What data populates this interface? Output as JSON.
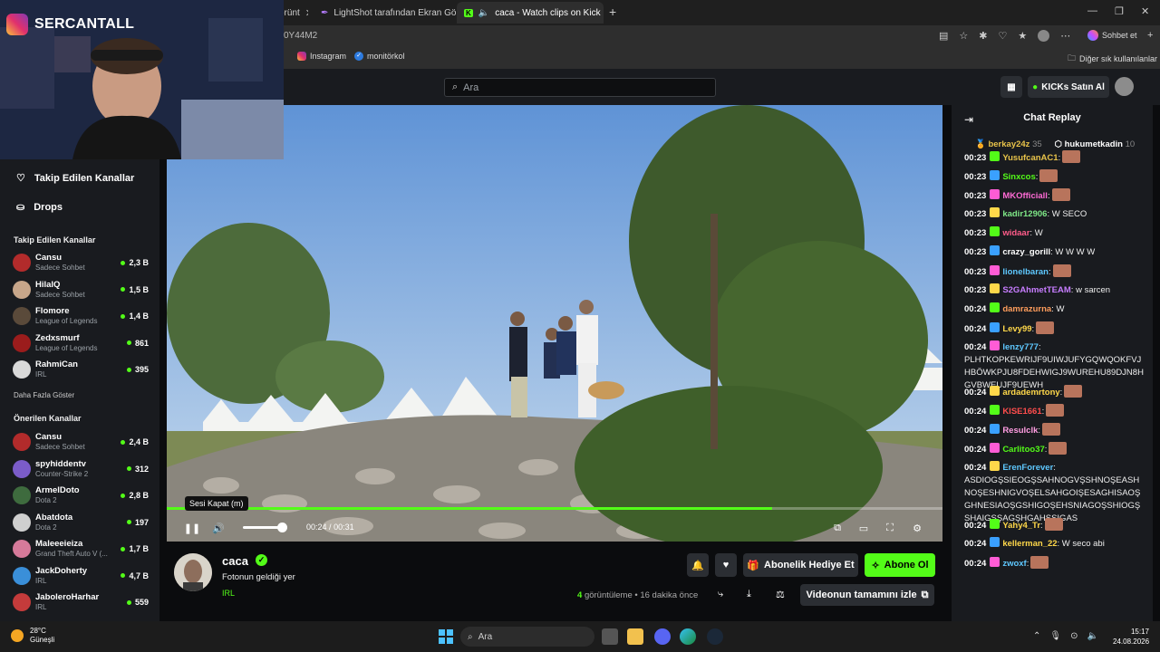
{
  "browser": {
    "tabs": [
      {
        "title": "örünt"
      },
      {
        "title": "LightShot tarafından Ekran Görünt"
      },
      {
        "title": "caca - Watch clips on Kick",
        "active": true
      }
    ],
    "address_fragment": "0Y44M2",
    "chat_button": "Sohbet et",
    "bookmarks": [
      "Instagram",
      "monitörkol"
    ],
    "other_bookmarks": "Diğer sık kullanılanlar"
  },
  "webcam": {
    "instagram_handle": "SERCANTALL"
  },
  "kick": {
    "search_placeholder": "Ara",
    "buy_kicks": "KICKs Satın Al",
    "sidebar": {
      "nav": [
        "Takip Edilen Kanallar",
        "Drops"
      ],
      "followed_heading": "Takip Edilen Kanallar",
      "followed": [
        {
          "name": "Cansu",
          "game": "Sadece Sohbet",
          "viewers": "2,3 B",
          "color": "#b22b2b"
        },
        {
          "name": "HilalQ",
          "game": "Sadece Sohbet",
          "viewers": "1,5 B",
          "color": "#c7a68a"
        },
        {
          "name": "Flomore",
          "game": "League of Legends",
          "viewers": "1,4 B",
          "color": "#5a4a3a"
        },
        {
          "name": "Zedxsmurf",
          "game": "League of Legends",
          "viewers": "861",
          "color": "#9b1c1c"
        },
        {
          "name": "RahmiCan",
          "game": "IRL",
          "viewers": "395",
          "color": "#d9d9d9"
        }
      ],
      "show_more": "Daha Fazla Göster",
      "recommended_heading": "Önerilen Kanallar",
      "recommended": [
        {
          "name": "Cansu",
          "game": "Sadece Sohbet",
          "viewers": "2,4 B",
          "color": "#b22b2b"
        },
        {
          "name": "spyhiddentv",
          "game": "Counter-Strike 2",
          "viewers": "312",
          "color": "#7b5cc9"
        },
        {
          "name": "ArmelDoto",
          "game": "Dota 2",
          "viewers": "2,8 B",
          "color": "#3e6b3e"
        },
        {
          "name": "Abatdota",
          "game": "Dota 2",
          "viewers": "197",
          "color": "#cfcfcf"
        },
        {
          "name": "Maleeeieiza",
          "game": "Grand Theft Auto V (...",
          "viewers": "1,7 B",
          "color": "#d67a9a"
        },
        {
          "name": "JackDoherty",
          "game": "IRL",
          "viewers": "4,7 B",
          "color": "#3a8fd9"
        },
        {
          "name": "JaboleroHarhar",
          "game": "IRL",
          "viewers": "559",
          "color": "#c43b3b"
        }
      ]
    },
    "player": {
      "tooltip": "Sesi Kapat (m)",
      "time_current": "00:24",
      "time_separator": "/",
      "time_total": "00:31",
      "progress": 0.78,
      "volume": 0.85
    },
    "clip": {
      "channel": "caca",
      "title": "Fotonun geldiği yer",
      "category": "IRL",
      "views_count": "4",
      "views_label": "görüntüleme",
      "age": "• 16 dakika önce",
      "gift_sub": "Abonelik Hediye Et",
      "subscribe": "Abone Ol",
      "watch_full": "Videonun tamamını izle"
    },
    "chat": {
      "title": "Chat Replay",
      "pinned": [
        {
          "user": "berkay24z",
          "count": "35"
        },
        {
          "user": "hukumetkadin",
          "count": "10"
        }
      ],
      "messages": [
        {
          "time": "00:23",
          "user": "YusufcanAC1",
          "color": "#e8c34a",
          "text": ":",
          "emote": true
        },
        {
          "time": "00:23",
          "user": "Sinxcos",
          "color": "#53fc18",
          "text": ":",
          "emote": true
        },
        {
          "time": "00:23",
          "user": "MKOfficiall",
          "color": "#ff6bd5",
          "text": ":",
          "emote": true
        },
        {
          "time": "00:23",
          "user": "kadir12906",
          "color": "#7ee787",
          "text": ": W SECO"
        },
        {
          "time": "00:23",
          "user": "widaar",
          "color": "#ff5c8a",
          "text": ": W"
        },
        {
          "time": "00:23",
          "user": "crazy_gorill",
          "color": "#ffffff",
          "text": ": W W W W"
        },
        {
          "time": "00:23",
          "user": "lionelbaran",
          "color": "#5ec8ff",
          "text": ":",
          "emote": true
        },
        {
          "time": "00:23",
          "user": "S2GAhmetTEAM",
          "color": "#c77dff",
          "text": ": w sarcen"
        },
        {
          "time": "00:24",
          "user": "damrazurna",
          "color": "#ff9d5c",
          "text": ": W"
        },
        {
          "time": "00:24",
          "user": "Levy99",
          "color": "#ffd84a",
          "text": ":",
          "emote": true
        },
        {
          "time": "00:24",
          "user": "lenzy777",
          "color": "#5ec8ff",
          "text": ": PLHTKOPKEWRIJF9UIWJUFYGQWQOKFVJHBÖWKPJU8FDEHWIGJ9WUREHU89DJN8HGVBWEUJF9UEWH"
        },
        {
          "time": "00:24",
          "user": "ardademrtony",
          "color": "#ffd84a",
          "text": ":",
          "emote": true
        },
        {
          "time": "00:24",
          "user": "KISE1661",
          "color": "#ff4d4d",
          "text": ":",
          "emote": true
        },
        {
          "time": "00:24",
          "user": "Resulclk",
          "color": "#ff9de2",
          "text": ":",
          "emote": true
        },
        {
          "time": "00:24",
          "user": "Carlitoo37",
          "color": "#53fc18",
          "text": ":",
          "emote": true
        },
        {
          "time": "00:24",
          "user": "ErenForever",
          "color": "#5ec8ff",
          "text": ": ASDIOGŞSIEOGŞSAHNOGVŞSHNOŞEASHNOŞESHNIGVOŞELSAHGOIŞESAGHISAOŞGHNESIAOŞGSHIGOŞEHSNIAGOŞSHIOGŞSHAIGSŞAGŞHGAHŞSIGAS"
        },
        {
          "time": "00:24",
          "user": "Yahy4_Tr",
          "color": "#ffd84a",
          "text": ":",
          "emote": true
        },
        {
          "time": "00:24",
          "user": "kellerman_22",
          "color": "#ffd84a",
          "text": ": W seco abi"
        },
        {
          "time": "00:24",
          "user": "zwoxf",
          "color": "#5ec8ff",
          "text": ":",
          "emote": true
        }
      ]
    }
  },
  "taskbar": {
    "weather_temp": "28°C",
    "weather_desc": "Güneşli",
    "search": "Ara",
    "time": "15:17",
    "date": "24.08.2026"
  }
}
